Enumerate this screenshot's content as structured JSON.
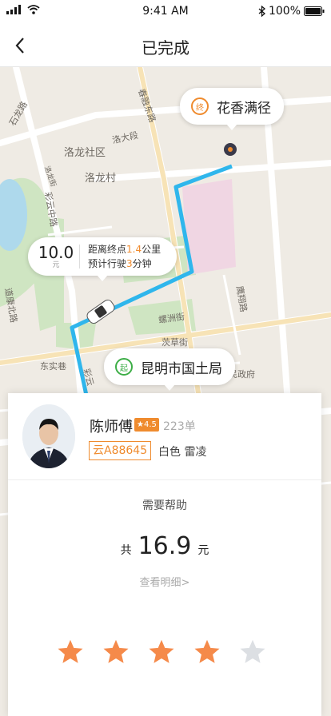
{
  "status_bar": {
    "time": "9:41 AM",
    "battery": "100%"
  },
  "nav": {
    "title": "已完成"
  },
  "map": {
    "road_labels": [
      "石龙路",
      "春融东路",
      "洛龙社区",
      "洛大段",
      "洛龙村",
      "彩云中路",
      "洛龙街",
      "道康北路",
      "螺洲街",
      "东实巷",
      "茨草街",
      "鹰翔路",
      "彩云",
      "民政府"
    ],
    "end_marker": {
      "badge": "终",
      "place": "花香满径"
    },
    "start_marker": {
      "badge": "起",
      "place": "昆明市国土局"
    },
    "eta": {
      "fare": "10.0",
      "fare_unit": "元",
      "line1_prefix": "距离终点",
      "distance": "1.4",
      "line1_suffix": "公里",
      "line2_prefix": "预计行驶",
      "minutes": "3",
      "line2_suffix": "分钟"
    }
  },
  "driver": {
    "name": "陈师傅",
    "rating": "★4.5",
    "trips": "223单",
    "plate": "云A88645",
    "car": "白色 雷凌"
  },
  "trip": {
    "help": "需要帮助",
    "total_prefix": "共",
    "total_amount": "16.9",
    "total_unit": "元",
    "detail": "查看明细>"
  },
  "rating": {
    "value": 4,
    "max": 5
  },
  "colors": {
    "accent": "#ef8b2e",
    "route": "#2fb6ec",
    "start": "#3dae47",
    "star_on": "#f58a4a",
    "star_off": "#dcdfe3"
  }
}
